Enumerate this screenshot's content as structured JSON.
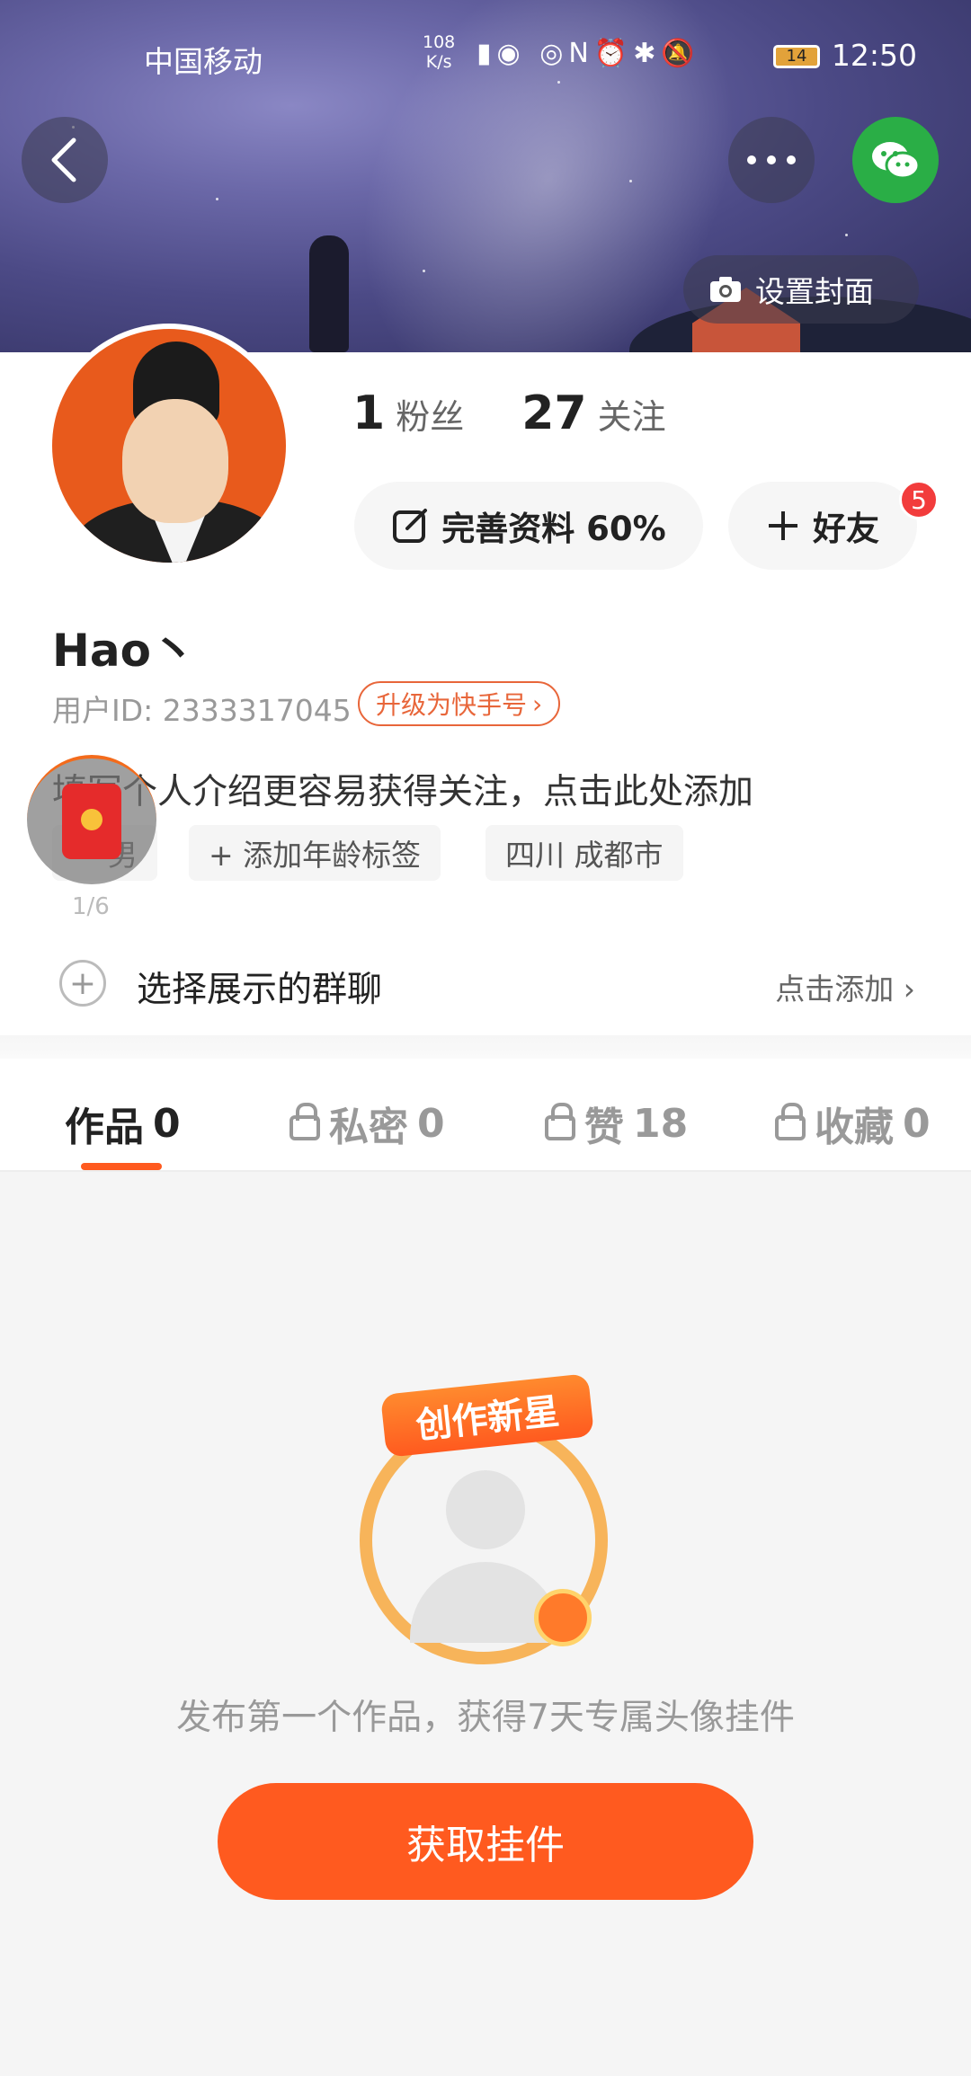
{
  "status_bar": {
    "carrier": "中国移动",
    "network_speed": "108\nK/s",
    "battery": "14",
    "time": "12:50"
  },
  "header": {
    "set_cover_label": "设置封面"
  },
  "profile": {
    "fans_count": "1",
    "fans_label": "粉丝",
    "following_count": "27",
    "following_label": "关注",
    "complete_profile_label": "完善资料 60%",
    "add_friend_label": "好友",
    "friend_badge": "5",
    "username": "Hao丶",
    "user_id": "用户ID: 2333317045",
    "upgrade_label": "升级为快手号",
    "bio_placeholder": "填写个人介绍更容易获得关注，点击此处添加",
    "tags": {
      "gender": "男",
      "age": "+ 添加年龄标签",
      "location": "四川 成都市"
    },
    "redpack_count": "1/6",
    "group_label": "选择展示的群聊",
    "group_action": "点击添加"
  },
  "tabs": [
    {
      "label": "作品",
      "count": "0"
    },
    {
      "label": "私密",
      "count": "0"
    },
    {
      "label": "赞",
      "count": "18"
    },
    {
      "label": "收藏",
      "count": "0"
    }
  ],
  "empty_state": {
    "medal_title": "创作新星",
    "message": "发布第一个作品，获得7天专属头像挂件",
    "button_label": "获取挂件"
  },
  "colors": {
    "accent": "#ff5a1f",
    "wechat": "#2aae46",
    "badge": "#f23c3c"
  }
}
